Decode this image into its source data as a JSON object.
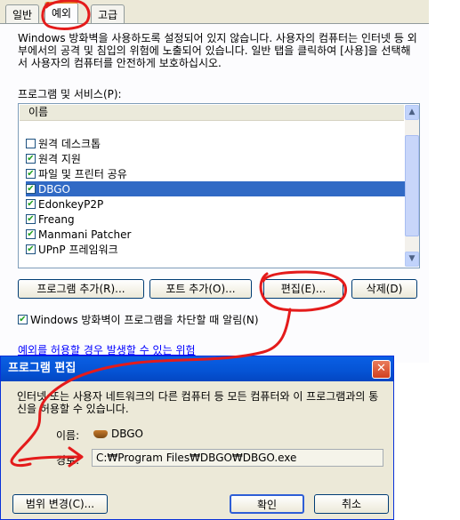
{
  "firewall": {
    "tabs": [
      {
        "label": "일반"
      },
      {
        "label": "예외"
      },
      {
        "label": "고급"
      }
    ],
    "description": "Windows 방화벽을 사용하도록 설정되어 있지 않습니다. 사용자의 컴퓨터는 인터넷 등 외부에서의 공격 및 침입의 위험에 노출되어 있습니다. 일반 탭을 클릭하여 [사용]을 선택해서 사용자의 컴퓨터를 안전하게 보호하십시오.",
    "list_label": "프로그램 및 서비스(P):",
    "list_header": "이름",
    "items": [
      {
        "label": "원격 데스크톱",
        "checked": false,
        "selected": false
      },
      {
        "label": "원격 지원",
        "checked": true,
        "selected": false
      },
      {
        "label": "파일 및 프린터 공유",
        "checked": true,
        "selected": false
      },
      {
        "label": "DBGO",
        "checked": true,
        "selected": true
      },
      {
        "label": "EdonkeyP2P",
        "checked": true,
        "selected": false
      },
      {
        "label": "Freang",
        "checked": true,
        "selected": false
      },
      {
        "label": "Manmani Patcher",
        "checked": true,
        "selected": false
      },
      {
        "label": "UPnP 프레임워크",
        "checked": true,
        "selected": false
      }
    ],
    "buttons": {
      "add_program": "프로그램 추가(R)...",
      "add_port": "포트 추가(O)...",
      "edit": "편집(E)...",
      "delete": "삭제(D)"
    },
    "notify_label": "Windows 방화벽이 프로그램을 차단할 때 알림(N)",
    "notify_checked": true,
    "risk_link": "예외를 허용할 경우 발생할 수 있는 위험"
  },
  "edit_dialog": {
    "title": "프로그램 편집",
    "description": "인터넷 또는 사용자 네트워크의 다른 컴퓨터 등 모든 컴퓨터와 이 프로그램과의 통신을 허용할 수 있습니다.",
    "name_label": "이름:",
    "name_value": "DBGO",
    "path_label": "경로:",
    "path_value": "C:₩Program Files₩DBGO₩DBGO.exe",
    "buttons": {
      "change_scope": "범위 변경(C)...",
      "ok": "확인",
      "cancel": "취소"
    }
  },
  "icons": {
    "check": "check-icon",
    "scroll_up": "chevron-up-icon",
    "scroll_down": "chevron-down-icon",
    "close": "close-icon",
    "program": "program-icon"
  },
  "colors": {
    "selection": "#316ac5",
    "annotation": "#e41b1b",
    "titlebar": "#0553d4",
    "link": "#0000ff"
  }
}
